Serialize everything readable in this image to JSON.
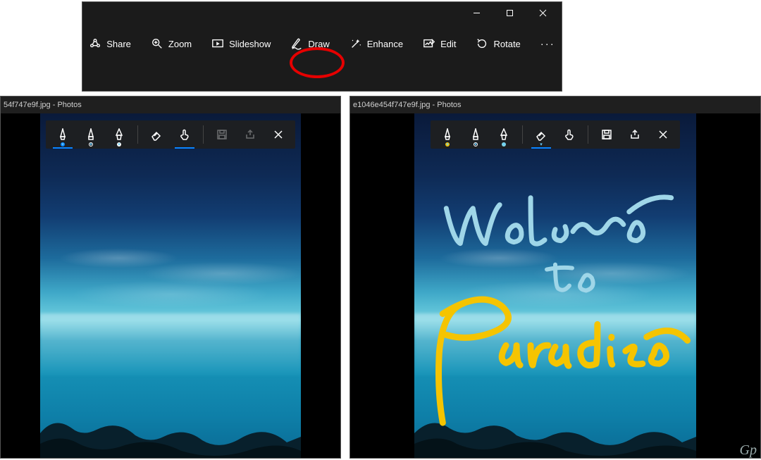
{
  "top_window": {
    "controls": {
      "minimize": "—",
      "maximize": "❐",
      "close": "✕"
    },
    "toolbar": [
      {
        "id": "share",
        "label": "Share",
        "icon": "share-icon"
      },
      {
        "id": "zoom",
        "label": "Zoom",
        "icon": "zoom-icon"
      },
      {
        "id": "slideshow",
        "label": "Slideshow",
        "icon": "slideshow-icon"
      },
      {
        "id": "draw",
        "label": "Draw",
        "icon": "draw-icon",
        "highlighted": true
      },
      {
        "id": "enhance",
        "label": "Enhance",
        "icon": "enhance-icon"
      },
      {
        "id": "edit",
        "label": "Edit",
        "icon": "edit-icon"
      },
      {
        "id": "rotate",
        "label": "Rotate",
        "icon": "rotate-icon"
      }
    ],
    "more_label": "···"
  },
  "left_window": {
    "title": "54f747e9f.jpg - Photos",
    "ink_toolbar": {
      "pens": [
        {
          "id": "pen1",
          "icon": "ballpoint-icon",
          "dot": "#0a84ff",
          "active": true
        },
        {
          "id": "pen2",
          "icon": "pencil-icon",
          "dot_outline": "#ffffff"
        },
        {
          "id": "pen3",
          "icon": "calligraphy-icon",
          "dot": "#ffffff"
        }
      ],
      "tools": [
        {
          "id": "eraser",
          "icon": "eraser-icon"
        },
        {
          "id": "touch",
          "icon": "touch-writing-icon",
          "active": true
        }
      ],
      "actions": [
        {
          "id": "save",
          "icon": "save-icon",
          "enabled": false
        },
        {
          "id": "share",
          "icon": "share-small-icon",
          "enabled": false
        },
        {
          "id": "close",
          "icon": "close-icon",
          "enabled": true
        }
      ]
    }
  },
  "right_window": {
    "title": "e1046e454f747e9f.jpg - Photos",
    "ink_toolbar": {
      "pens": [
        {
          "id": "pen1",
          "icon": "ballpoint-icon",
          "dot": "#f5c400"
        },
        {
          "id": "pen2",
          "icon": "pencil-icon",
          "dot_outline": "#ffffff"
        },
        {
          "id": "pen3",
          "icon": "calligraphy-icon",
          "dot": "#7fd7e6"
        }
      ],
      "tools": [
        {
          "id": "eraser",
          "icon": "eraser-icon",
          "active": true
        },
        {
          "id": "touch",
          "icon": "touch-writing-icon"
        }
      ],
      "actions": [
        {
          "id": "save",
          "icon": "save-icon",
          "enabled": true
        },
        {
          "id": "share",
          "icon": "share-small-icon",
          "enabled": true
        },
        {
          "id": "close",
          "icon": "close-icon",
          "enabled": true
        }
      ]
    },
    "handwriting": {
      "line1_text": "Welcome",
      "line2_text": "to",
      "line3_text": "Paradise",
      "line1_color": "#9fd6e8",
      "line2_color": "#9fd6e8",
      "line3_color": "#f5c400"
    }
  },
  "watermark": "Gp"
}
